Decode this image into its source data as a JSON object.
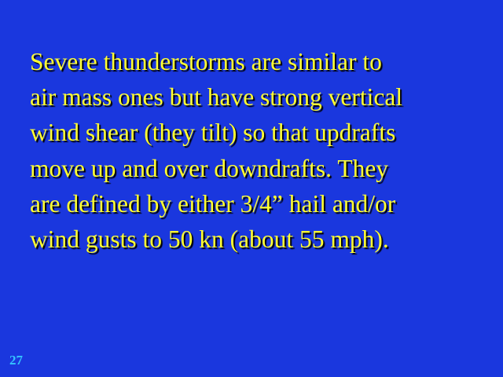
{
  "slide": {
    "body_lines": [
      "Severe thunderstorms are similar to",
      "air mass ones but have strong vertical",
      "wind shear (they tilt) so that updrafts",
      "move up and over downdrafts. They",
      "are defined by either 3/4” hail and/or",
      "wind gusts to 50 kn (about 55 mph)."
    ],
    "number": "27",
    "colors": {
      "background": "#1a37de",
      "text": "#ffff33",
      "slide_number": "#35c4ff"
    }
  }
}
